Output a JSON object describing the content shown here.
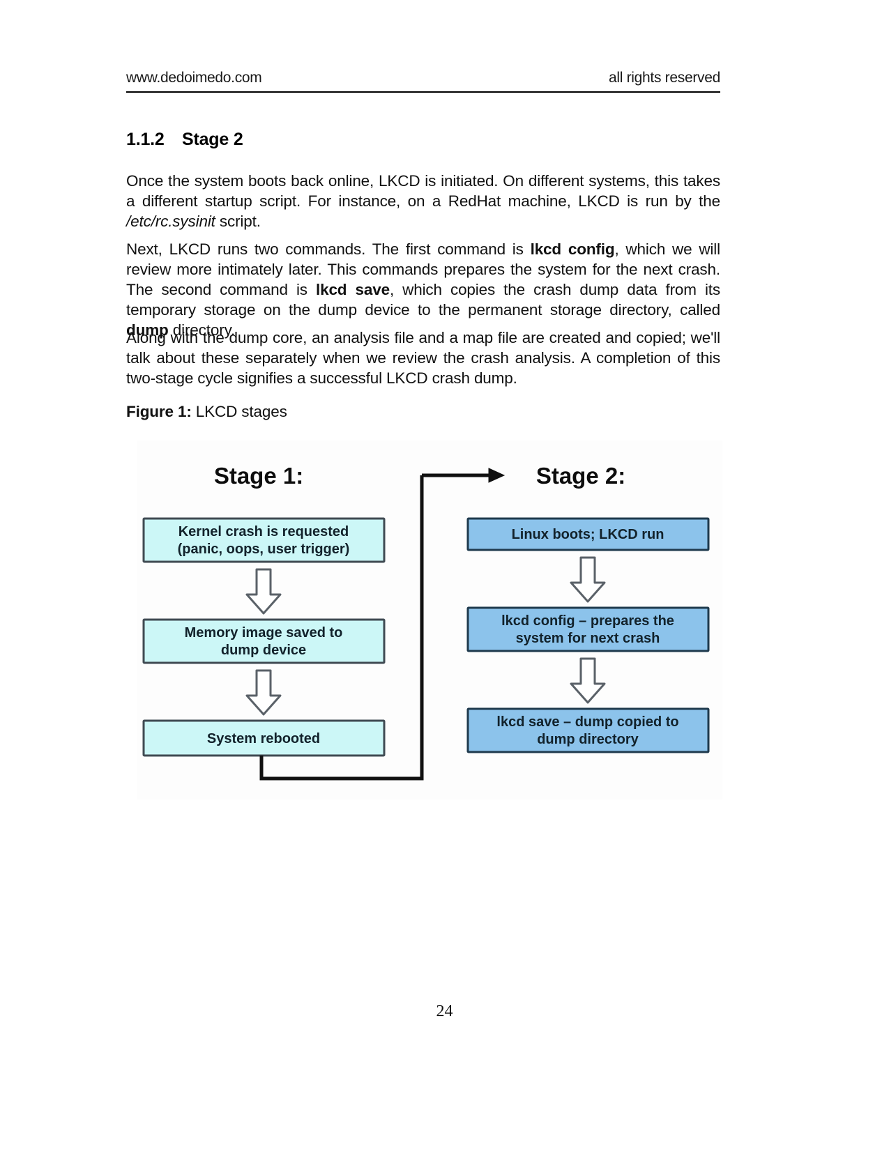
{
  "header": {
    "left": "www.dedoimedo.com",
    "right": "all rights reserved"
  },
  "section": {
    "number": "1.1.2",
    "title": "Stage 2"
  },
  "paragraphs": {
    "p1_a": "Once the system boots back online, LKCD is initiated. On different systems, this takes a different startup script. For instance, on a RedHat machine, LKCD is run by the ",
    "p1_em": "/etc/rc.sysinit",
    "p1_b": " script.",
    "p2_a": "Next, LKCD runs two commands. The first command is ",
    "p2_b1": "lkcd config",
    "p2_b": ", which we will review more intimately later. This commands prepares the system for the next crash. The second command is ",
    "p2_b2": "lkcd save",
    "p2_c": ", which copies the crash dump data from its temporary storage on the dump device to the permanent storage directory, called ",
    "p2_b3": "dump",
    "p2_d": " directory.",
    "p3": "Along with the dump core, an analysis file and a map file are created and copied; we'll talk about these separately when we review the crash analysis. A completion of this two-stage cycle signifies a successful LKCD crash dump."
  },
  "figure": {
    "caption_label": "Figure 1:",
    "caption_text": " LKCD stages",
    "colors": {
      "stage1_fill": "#ccf7f7",
      "stage2_fill": "#8cc3eb",
      "box_border": "#3f4a52",
      "arrow_stroke": "#5a6168",
      "arrow_fill": "#ffffff",
      "connector": "#111111",
      "background": "#fdfdfd"
    },
    "stage1": {
      "title": "Stage 1:",
      "boxes": [
        {
          "line1": "Kernel crash is requested",
          "line2": "(panic, oops, user trigger)"
        },
        {
          "line1": "Memory image saved to",
          "line2": "dump device"
        },
        {
          "line1": "System rebooted",
          "line2": ""
        }
      ]
    },
    "stage2": {
      "title": "Stage 2:",
      "boxes": [
        {
          "line1": "Linux boots; LKCD run",
          "line2": ""
        },
        {
          "line1": "lkcd config – prepares the",
          "line2": "system for next crash"
        },
        {
          "line1": "lkcd save – dump copied to",
          "line2": "dump directory"
        }
      ]
    }
  },
  "footer": {
    "page_number": "24"
  }
}
